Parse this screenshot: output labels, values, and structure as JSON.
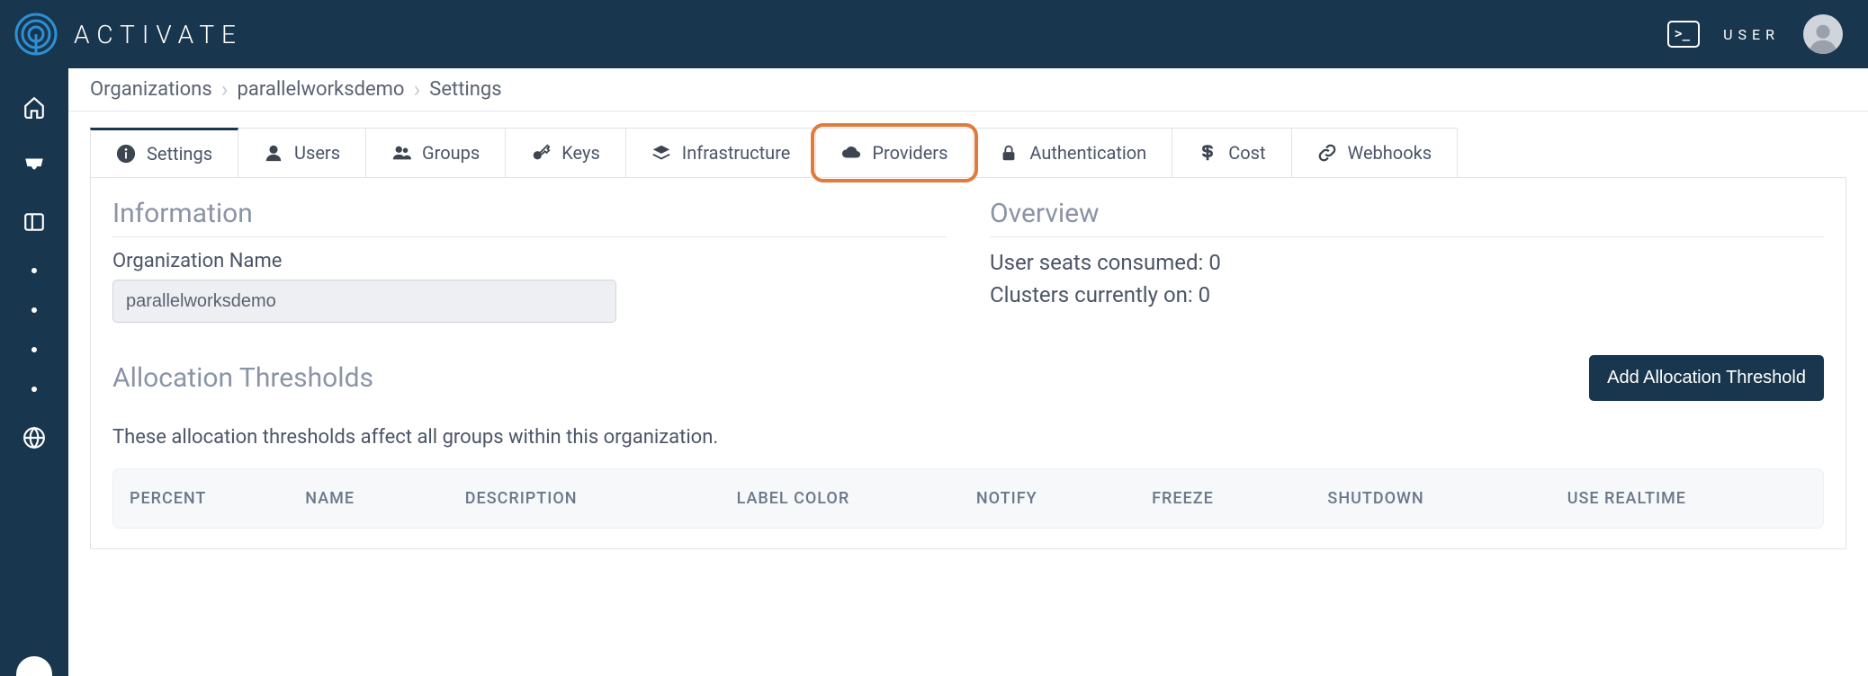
{
  "brand": {
    "name": "ACTIVATE"
  },
  "header": {
    "user_label": "USER",
    "terminal_glyph": ">_"
  },
  "breadcrumb": {
    "items": [
      "Organizations",
      "parallelworksdemo",
      "Settings"
    ]
  },
  "tabs": [
    {
      "label": "Settings",
      "icon": "info"
    },
    {
      "label": "Users",
      "icon": "user"
    },
    {
      "label": "Groups",
      "icon": "group"
    },
    {
      "label": "Keys",
      "icon": "key"
    },
    {
      "label": "Infrastructure",
      "icon": "layers"
    },
    {
      "label": "Providers",
      "icon": "cloud"
    },
    {
      "label": "Authentication",
      "icon": "lock"
    },
    {
      "label": "Cost",
      "icon": "dollar"
    },
    {
      "label": "Webhooks",
      "icon": "link"
    }
  ],
  "sections": {
    "information": {
      "title": "Information",
      "org_name_label": "Organization Name",
      "org_name_value": "parallelworksdemo"
    },
    "overview": {
      "title": "Overview",
      "seats_line": "User seats consumed: 0",
      "clusters_line": "Clusters currently on: 0"
    },
    "allocation": {
      "title": "Allocation Thresholds",
      "add_button": "Add Allocation Threshold",
      "description": "These allocation thresholds affect all groups within this organization.",
      "columns": [
        "PERCENT",
        "NAME",
        "DESCRIPTION",
        "LABEL COLOR",
        "NOTIFY",
        "FREEZE",
        "SHUTDOWN",
        "USE REALTIME"
      ]
    }
  }
}
